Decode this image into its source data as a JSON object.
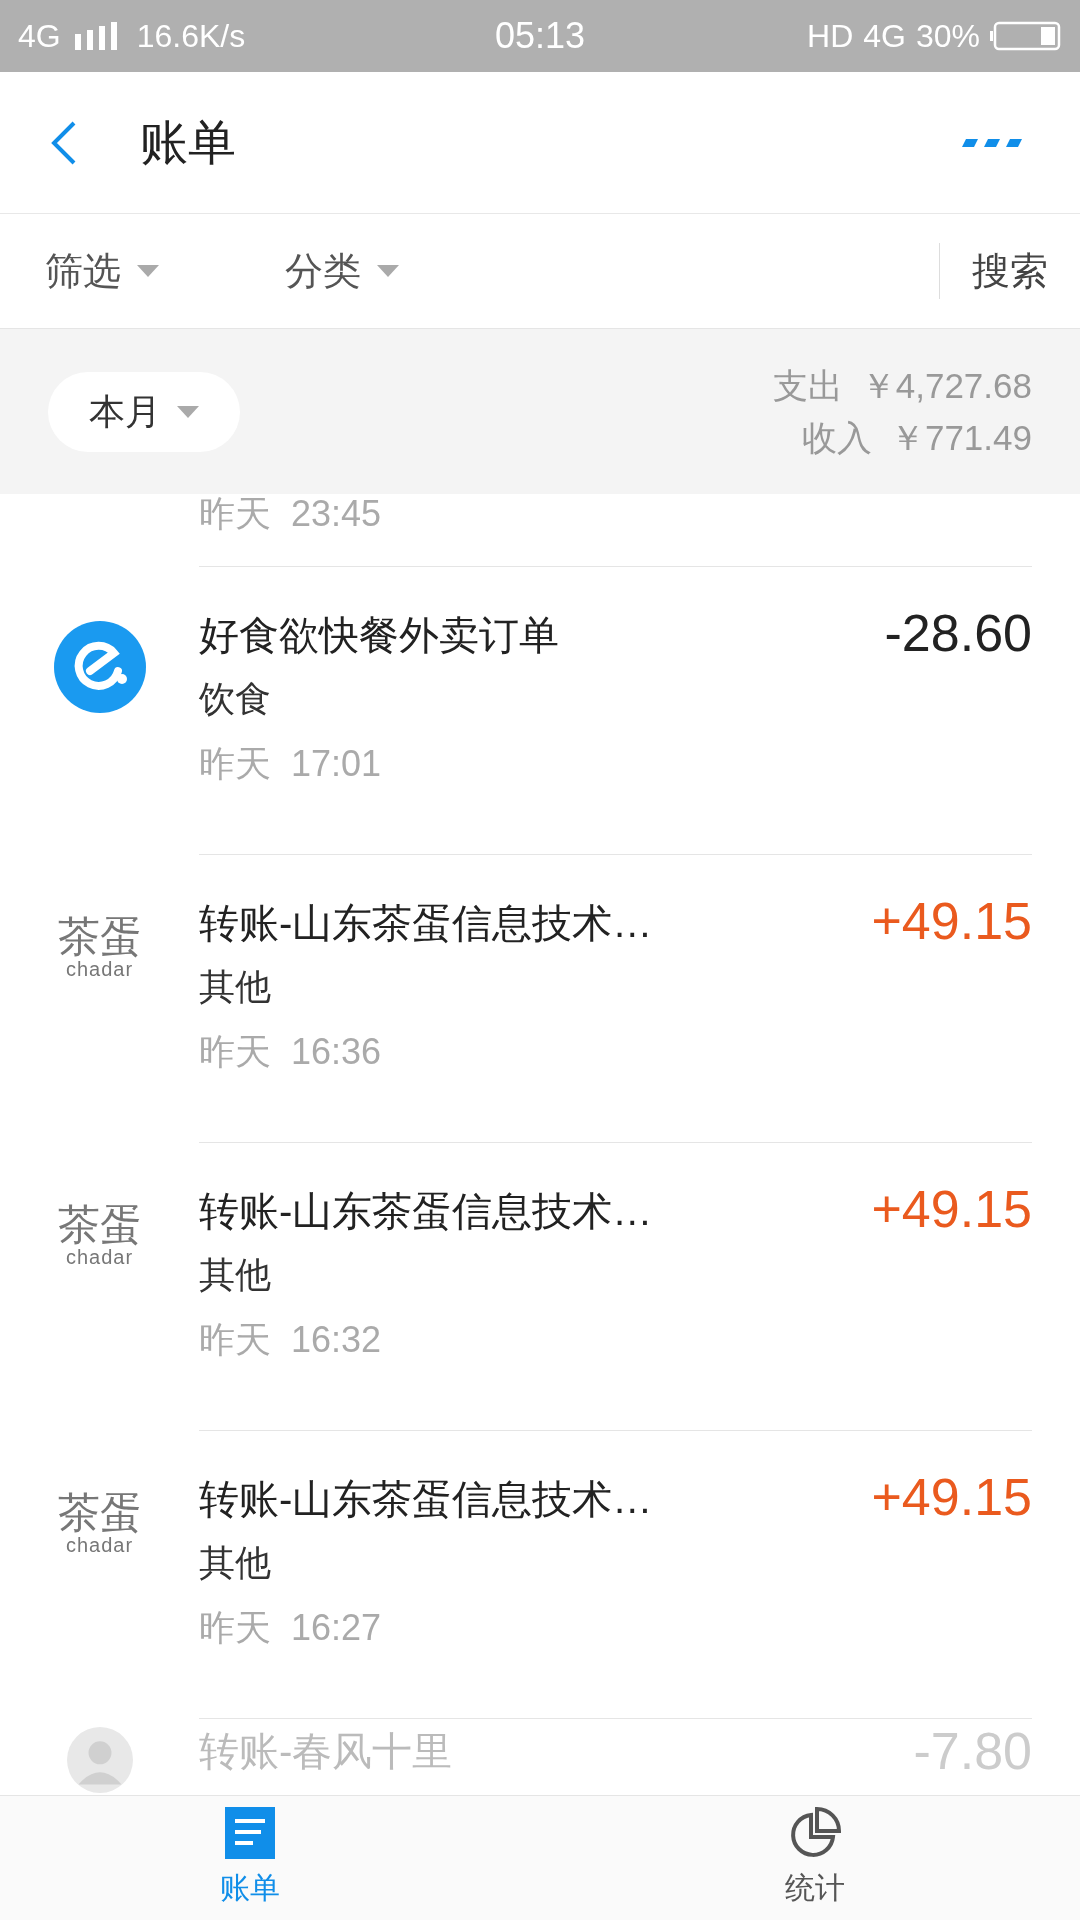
{
  "status_bar": {
    "network": "4G",
    "speed": "16.6K/s",
    "time": "05:13",
    "hd": "HD",
    "network_right": "4G",
    "battery": "30%"
  },
  "header": {
    "title": "账单"
  },
  "filter_bar": {
    "filters": [
      {
        "label": "筛选"
      },
      {
        "label": "分类"
      }
    ],
    "search": "搜索"
  },
  "summary": {
    "period": "本月",
    "expense_label": "支出",
    "expense": "￥4,727.68",
    "income_label": "收入",
    "income": "￥771.49"
  },
  "partial_row": {
    "time": "昨天  23:45"
  },
  "transactions": [
    {
      "kind": "round_logo",
      "title": "好食欲快餐外卖订单",
      "category": "饮食",
      "time": "昨天  17:01",
      "amount": "-28.60",
      "color": "#222222"
    },
    {
      "kind": "text_logo",
      "logo_text": "茶蛋",
      "logo_subtext": "chadar",
      "title": "转账-山东茶蛋信息技术…",
      "category": "其他",
      "time": "昨天  16:36",
      "amount": "+49.15",
      "color": "#ea5a1e"
    },
    {
      "kind": "text_logo",
      "logo_text": "茶蛋",
      "logo_subtext": "chadar",
      "title": "转账-山东茶蛋信息技术…",
      "category": "其他",
      "time": "昨天  16:32",
      "amount": "+49.15",
      "color": "#ea5a1e"
    },
    {
      "kind": "text_logo",
      "logo_text": "茶蛋",
      "logo_subtext": "chadar",
      "title": "转账-山东茶蛋信息技术…",
      "category": "其他",
      "time": "昨天  16:27",
      "amount": "+49.15",
      "color": "#ea5a1e"
    },
    {
      "kind": "avatar",
      "title": "转账-春风十里",
      "amount": "-7.80",
      "color": "#cccccc"
    }
  ],
  "tab_bar": [
    {
      "label": "账单",
      "selected": true,
      "kind": "list"
    },
    {
      "label": "统计",
      "selected": false,
      "kind": "pie"
    }
  ]
}
